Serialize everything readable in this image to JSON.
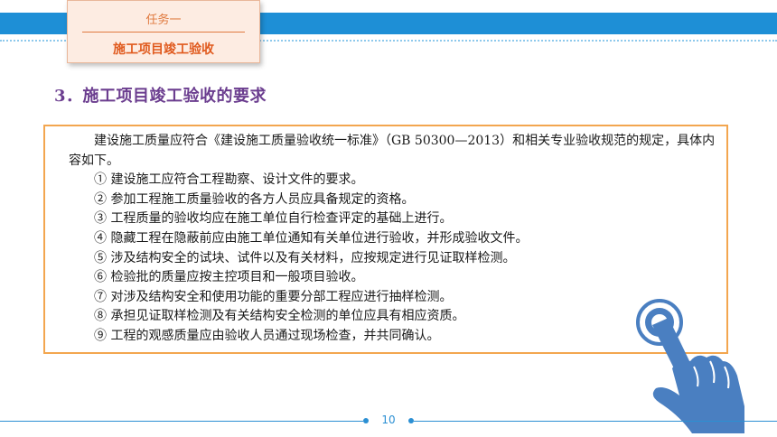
{
  "header": {
    "task_label": "任务一",
    "task_title": "施工项目竣工验收"
  },
  "section": {
    "heading": "3．施工项目竣工验收的要求"
  },
  "content": {
    "intro": "建设施工质量应符合《建设施工质量验收统一标准》（GB 50300—2013）和相关专业验收规范的规定，具体内容如下。",
    "items": [
      "① 建设施工应符合工程勘察、设计文件的要求。",
      "② 参加工程施工质量验收的各方人员应具备规定的资格。",
      "③ 工程质量的验收均应在施工单位自行检查评定的基础上进行。",
      "④ 隐藏工程在隐蔽前应由施工单位通知有关单位进行验收，并形成验收文件。",
      "⑤ 涉及结构安全的试块、试件以及有关材料，应按规定进行见证取样检测。",
      "⑥ 检验批的质量应按主控项目和一般项目验收。",
      "⑦ 对涉及结构安全和使用功能的重要分部工程应进行抽样检测。",
      "⑧ 承担见证取样检测及有关结构安全检测的单位应具有相应资质。",
      "⑨ 工程的观感质量应由验收人员通过现场检查，并共同确认。"
    ]
  },
  "footer": {
    "page_number": "10"
  },
  "colors": {
    "band_blue": "#1e8fd6",
    "heading_purple": "#6b3d8f",
    "box_border_orange": "#f3a64f",
    "task_orange": "#e05a1e"
  },
  "icons": {
    "hand": "hand-tap-icon"
  }
}
